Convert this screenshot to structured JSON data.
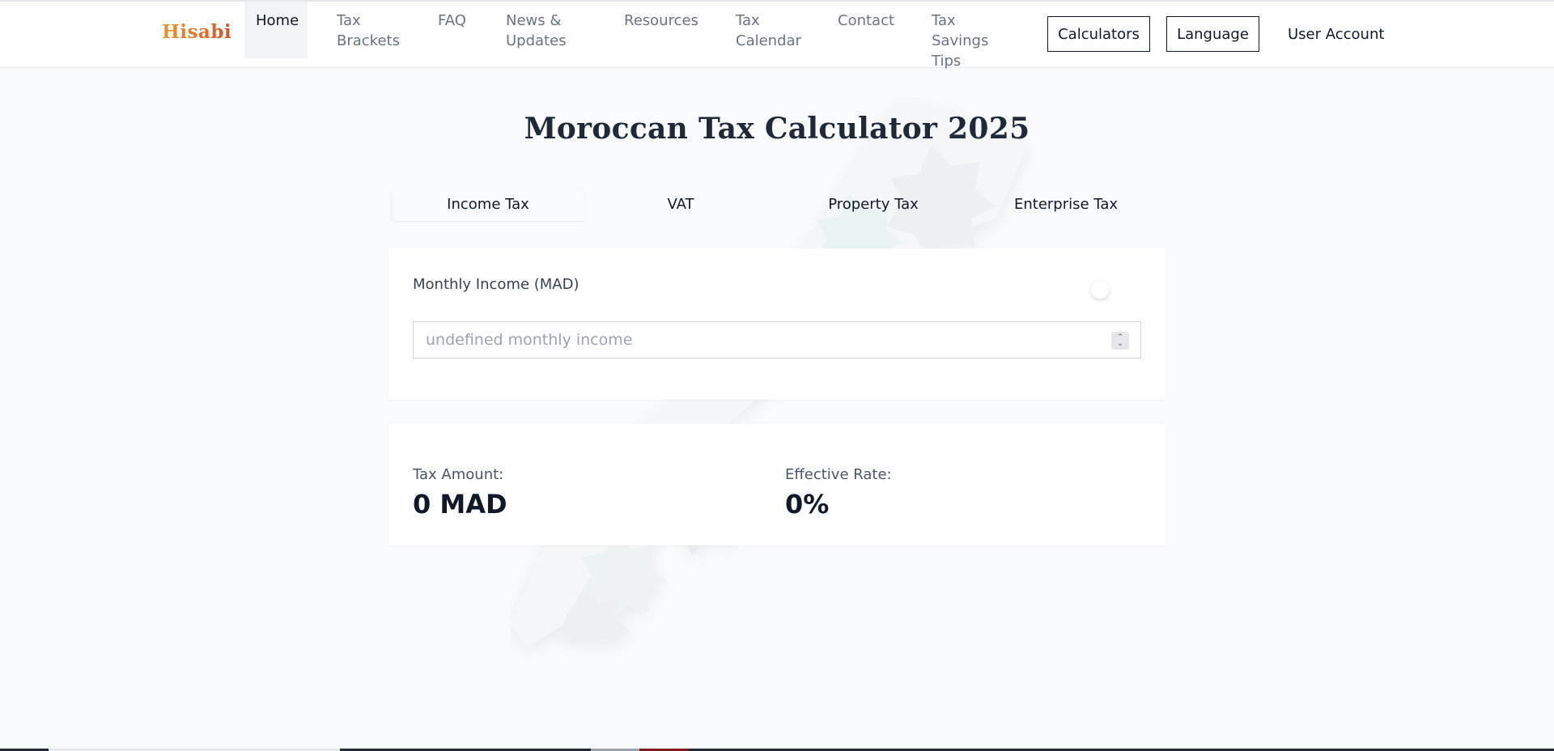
{
  "brand": {
    "logo_text": "Hisabi"
  },
  "nav": {
    "items": [
      {
        "label": "Home"
      },
      {
        "label": "Tax Brackets"
      },
      {
        "label": "FAQ"
      },
      {
        "label": "News & Updates"
      },
      {
        "label": "Resources"
      },
      {
        "label": "Tax Calendar"
      },
      {
        "label": "Contact"
      },
      {
        "label": "Tax Savings Tips"
      }
    ],
    "active_item": "Home",
    "calculators_label": "Calculators",
    "language_label": "Language",
    "user_account_label": "User Account"
  },
  "page": {
    "title": "Moroccan Tax Calculator 2025"
  },
  "tabs": [
    {
      "label": "Income Tax"
    },
    {
      "label": "VAT"
    },
    {
      "label": "Property Tax"
    },
    {
      "label": "Enterprise Tax"
    }
  ],
  "active_tab": "Income Tax",
  "income_form": {
    "label": "Monthly Income (MAD)",
    "value": "",
    "placeholder": "undefined monthly income"
  },
  "results": {
    "tax_amount_label": "Tax Amount:",
    "tax_amount_value": "0 MAD",
    "effective_rate_label": "Effective Rate:",
    "effective_rate_value": "0%"
  },
  "colors": {
    "logo_gradient_start": "#e8962a",
    "logo_gradient_end": "#d2542a",
    "page_background": "#f9fafb",
    "card_background": "#ffffff",
    "text_primary": "#111827",
    "text_muted": "#6b7280"
  },
  "icons": {
    "input_spinner": "chevron-up-down-icon",
    "background_decoration": "morocco-map-pattern"
  }
}
